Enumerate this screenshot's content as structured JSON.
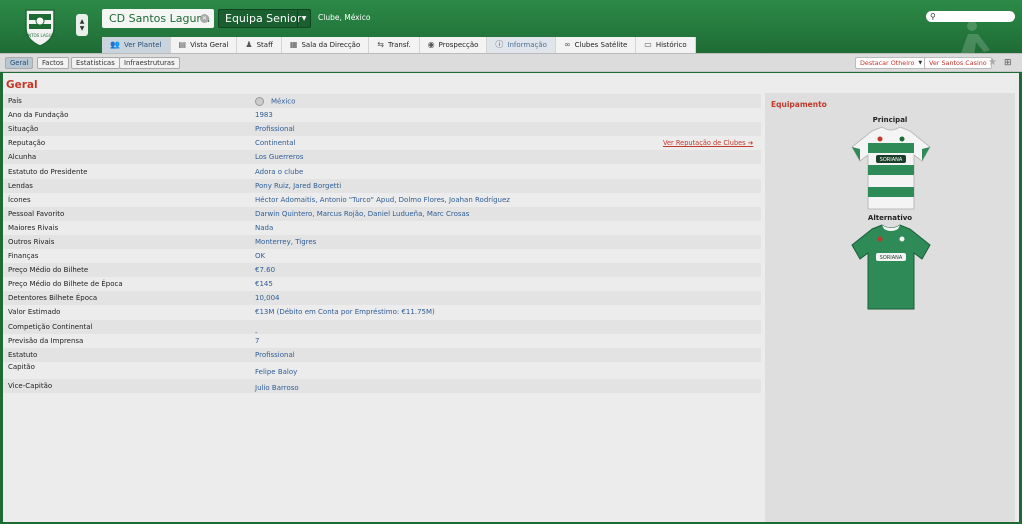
{
  "header": {
    "club_name": "CD Santos Laguna",
    "team_selector": "Equipa Senior",
    "club_location": "Clube, México",
    "crest_text": "SANTOS LAGUNA",
    "search_placeholder": ""
  },
  "tabs": [
    {
      "label": "Ver Plantel",
      "icon": "players-icon"
    },
    {
      "label": "Vista Geral",
      "icon": "overview-icon"
    },
    {
      "label": "Staff",
      "icon": "staff-icon"
    },
    {
      "label": "Sala da Direcção",
      "icon": "boardroom-icon"
    },
    {
      "label": "Transf.",
      "icon": "transfer-icon"
    },
    {
      "label": "Prospecção",
      "icon": "scouting-icon"
    },
    {
      "label": "Informação",
      "icon": "info-icon"
    },
    {
      "label": "Clubes Satélite",
      "icon": "link-icon"
    },
    {
      "label": "Histórico",
      "icon": "history-icon"
    }
  ],
  "subtabs": [
    "Geral",
    "Factos",
    "Estatísticas",
    "Infraestruturas"
  ],
  "toolbar": {
    "highlight_rival": "Destacar Otheiro",
    "view_casino": "Ver Santos Casino"
  },
  "section_title": "Geral",
  "details": [
    {
      "label": "País",
      "value": "México"
    },
    {
      "label": "Ano da Fundação",
      "value": "1983"
    },
    {
      "label": "Situação",
      "value": "Profissional"
    },
    {
      "label": "Reputação",
      "value": "Continental"
    },
    {
      "label": "Alcunha",
      "value": "Los Guerreros"
    },
    {
      "label": "Estatuto do Presidente",
      "value": "Adora o clube"
    },
    {
      "label": "Lendas",
      "value": "Pony Ruiz, Jared Borgetti"
    },
    {
      "label": "Ícones",
      "value": "Héctor Adomaitis, Antonio \"Turco\" Apud, Dolmo Flores, Joahan Rodríguez"
    },
    {
      "label": "Pessoal Favorito",
      "value": "Darwin Quintero, Marcus Rojão, Daniel Ludueña, Marc Crosas"
    },
    {
      "label": "Maiores Rivais",
      "value": "Nada"
    },
    {
      "label": "Outros Rivais",
      "value": "Monterrey, Tigres"
    },
    {
      "label": "Finanças",
      "value": "OK"
    },
    {
      "label": "Preço Médio do Bilhete",
      "value": "€7.60"
    },
    {
      "label": "Preço Médio do Bilhete de Época",
      "value": "€145"
    },
    {
      "label": "Detentores Bilhete Época",
      "value": "10,004"
    },
    {
      "label": "Valor Estimado",
      "value": "€13M (Débito em Conta por Empréstimo: €11.75M)"
    },
    {
      "label": "Competição Continental",
      "value": "-"
    },
    {
      "label": "Previsão da Imprensa",
      "value": "7"
    },
    {
      "label": "Estatuto",
      "value": "Profissional"
    },
    {
      "label": "Capitão",
      "value": "Felipe Baloy"
    },
    {
      "label": "Vice-Capitão",
      "value": "Julio Barroso"
    }
  ],
  "reputation_link": "Ver Reputação de Clubes",
  "kits": {
    "title": "Equipamento",
    "home_label": "Principal",
    "away_label": "Alternativo",
    "sponsor": "SORIANA"
  },
  "colors": {
    "header_green": "#1e6a35",
    "accent_red": "#c0392b",
    "link_blue": "#2e5d96",
    "kit_green": "#2e8b57",
    "kit_white": "#f4f4f4"
  }
}
